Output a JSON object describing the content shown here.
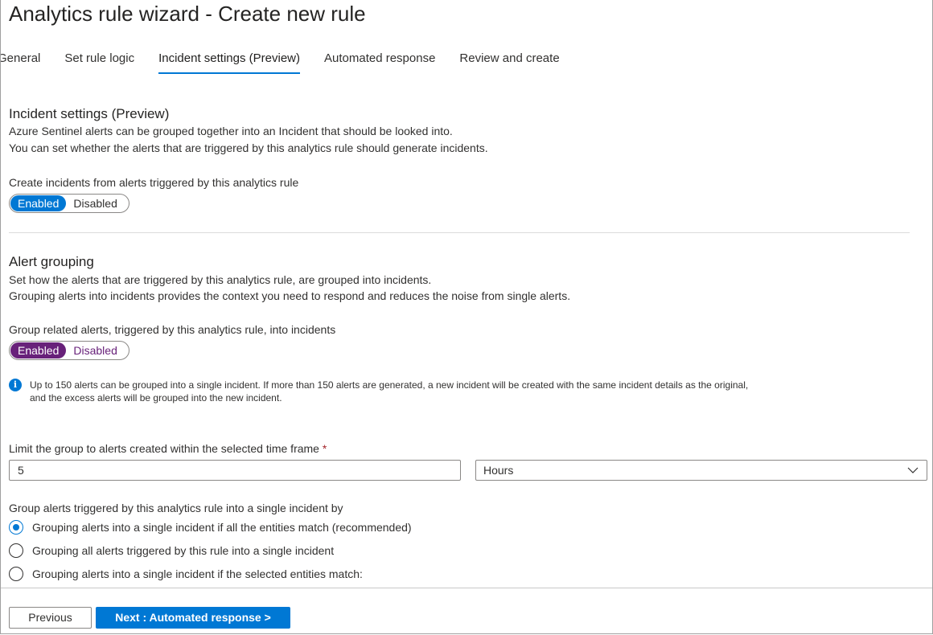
{
  "header": {
    "title": "Analytics rule wizard - Create new rule"
  },
  "tabs": [
    {
      "label": "General",
      "active": false
    },
    {
      "label": "Set rule logic",
      "active": false
    },
    {
      "label": "Incident settings (Preview)",
      "active": true
    },
    {
      "label": "Automated response",
      "active": false
    },
    {
      "label": "Review and create",
      "active": false
    }
  ],
  "incident_settings": {
    "title": "Incident settings (Preview)",
    "desc1": "Azure Sentinel alerts can be grouped together into an Incident that should be looked into.",
    "desc2": "You can set whether the alerts that are triggered by this analytics rule should generate incidents.",
    "create_label": "Create incidents from alerts triggered by this analytics rule",
    "toggle": {
      "on_label": "Enabled",
      "off_label": "Disabled",
      "value": "Enabled",
      "color": "#0078d4"
    }
  },
  "alert_grouping": {
    "title": "Alert grouping",
    "desc1": "Set how the alerts that are triggered by this analytics rule, are grouped into incidents.",
    "desc2": "Grouping alerts into incidents provides the context you need to respond and reduces the noise from single alerts.",
    "group_label": "Group related alerts, triggered by this analytics rule, into incidents",
    "toggle": {
      "on_label": "Enabled",
      "off_label": "Disabled",
      "value": "Enabled",
      "color": "#68217a"
    },
    "info_line1": "Up to 150 alerts can be grouped into a single incident. If more than 150 alerts are generated, a new incident will be created with the same incident details as the original,",
    "info_line2": "and the excess alerts will be grouped into the new incident.",
    "limit_label": "Limit the group to alerts created within the selected time frame",
    "required_mark": "*",
    "limit_value": "5",
    "unit_value": "Hours",
    "group_by_label": "Group alerts triggered by this analytics rule into a single incident by",
    "options": [
      {
        "label": "Grouping alerts into a single incident if all the entities match (recommended)",
        "checked": true
      },
      {
        "label": "Grouping all alerts triggered by this rule into a single incident",
        "checked": false
      },
      {
        "label": "Grouping alerts into a single incident if the selected entities match:",
        "checked": false
      }
    ]
  },
  "footer": {
    "previous_label": "Previous",
    "next_label": "Next : Automated response >"
  }
}
